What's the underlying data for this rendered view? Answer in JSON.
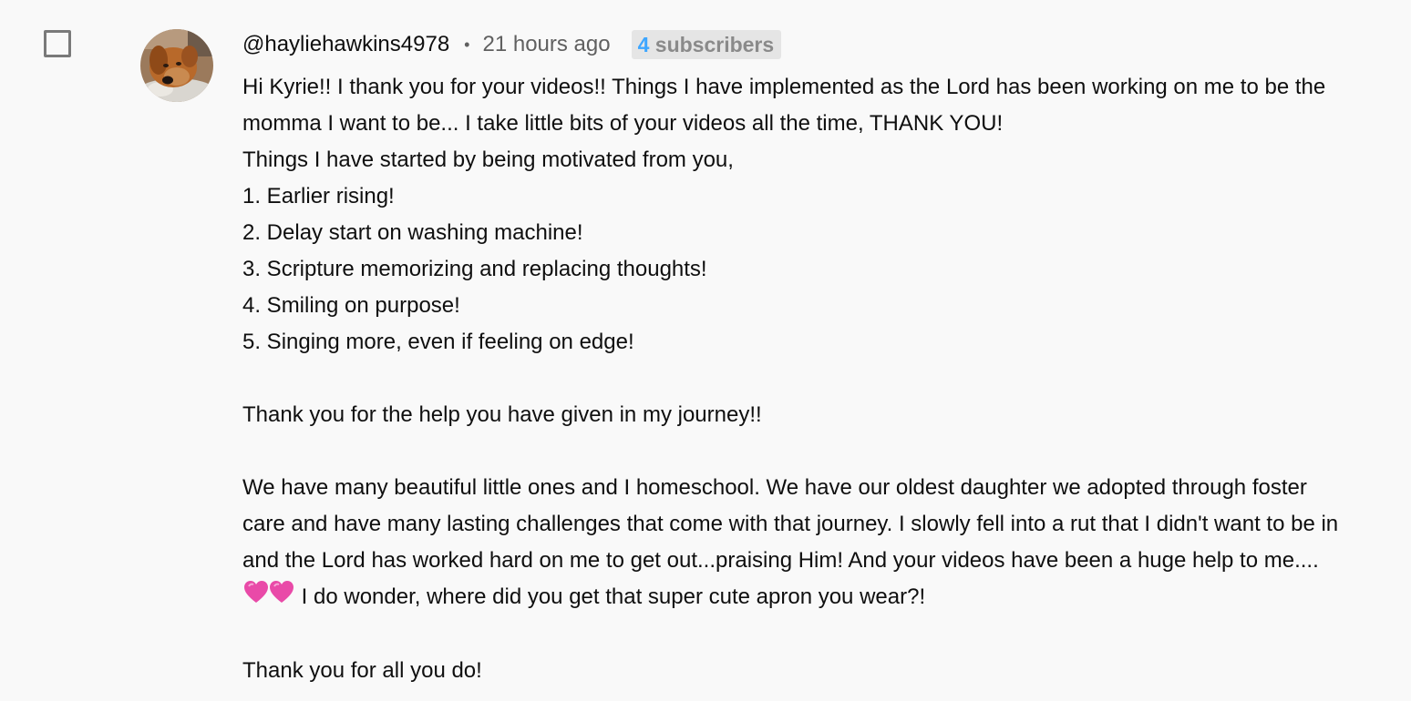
{
  "comment": {
    "author": "@hayliehawkins4978",
    "separator": "•",
    "timestamp": "21 hours ago",
    "subscriber_count": "4",
    "subscriber_label": "subscribers",
    "avatar_icon": "dog-avatar-icon",
    "checkbox_checked": false,
    "paragraphs": {
      "p1": "Hi Kyrie!! I thank you for your videos!! Things I have implemented as the Lord has been working on me to be the momma I want to be... I take little bits of your videos all the time, THANK YOU!",
      "p2": "Things I have started by being motivated from you,",
      "list": [
        "1. Earlier rising!",
        "2. Delay start on washing machine!",
        "3. Scripture memorizing and replacing thoughts!",
        "4. Smiling on purpose!",
        "5. Singing more, even if feeling on edge!"
      ],
      "p3": "Thank you for the help you have given in my journey!!",
      "p4_start": "We have many beautiful little ones and I homeschool. We have our oldest daughter we adopted through foster care and have many lasting challenges that come with that journey. I slowly fell into a rut that I didn't want to be in and the Lord has worked hard on me to get out...praising Him! And your videos have been a huge help to me....",
      "p4_emoji": "💗💗",
      "p4_end": "I do wonder, where did you get that super cute apron you wear?!",
      "p5": "Thank you for all you do!"
    }
  },
  "colors": {
    "background": "#f9f9f9",
    "text": "#0f0f0f",
    "secondary_text": "#606060",
    "subscriber_count": "#3ea6ff",
    "badge_bg": "#e5e5e5",
    "heart": "#e94aa8"
  }
}
